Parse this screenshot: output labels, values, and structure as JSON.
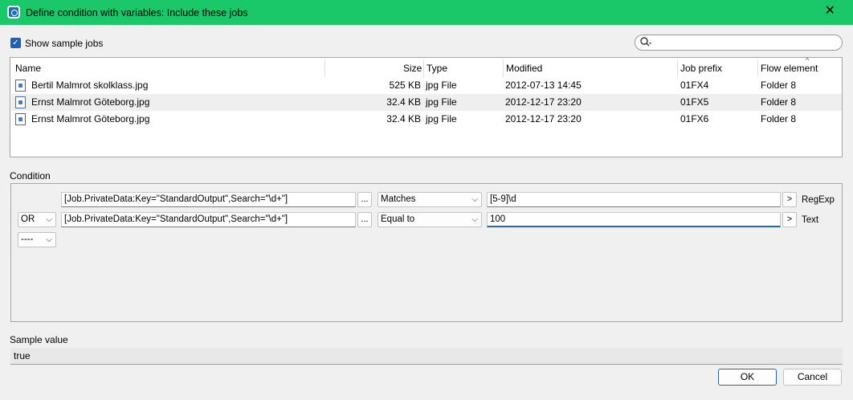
{
  "window": {
    "title": "Define condition with variables: Include these jobs",
    "close_glyph": "✕"
  },
  "toolbar": {
    "show_sample_jobs_label": "Show sample jobs",
    "show_sample_jobs_checked": true,
    "search_placeholder": ""
  },
  "jobs_table": {
    "columns": [
      "Name",
      "Size",
      "Type",
      "Modified",
      "Job prefix",
      "Flow element"
    ],
    "rows": [
      {
        "name": "Bertil Malmrot skolklass.jpg",
        "size": "525 KB",
        "type": "jpg File",
        "modified": "2012-07-13 14:45",
        "prefix": "01FX4",
        "element": "Folder 8"
      },
      {
        "name": "Ernst Malmrot Göteborg.jpg",
        "size": "32.4 KB",
        "type": "jpg File",
        "modified": "2012-12-17 23:20",
        "prefix": "01FX5",
        "element": "Folder 8"
      },
      {
        "name": "Ernst Malmrot Göteborg.jpg",
        "size": "32.4 KB",
        "type": "jpg File",
        "modified": "2012-12-17 23:20",
        "prefix": "01FX6",
        "element": "Folder 8"
      }
    ]
  },
  "condition": {
    "label": "Condition",
    "rows": [
      {
        "logic": "",
        "variable": "[Job.PrivateData:Key=\"StandardOutput\",Search=\"\\d+\"]",
        "browse": "...",
        "operator": "Matches",
        "value": "[5-9]\\d",
        "apply": ">",
        "type": "RegExp"
      },
      {
        "logic": "OR",
        "variable": "[Job.PrivateData:Key=\"StandardOutput\",Search=\"\\d+\"]",
        "browse": "...",
        "operator": "Equal to",
        "value": "100",
        "apply": ">",
        "type": "Text"
      }
    ],
    "add_logic": "----"
  },
  "sample": {
    "label": "Sample value",
    "value": "true"
  },
  "buttons": {
    "ok": "OK",
    "cancel": "Cancel"
  },
  "colors": {
    "titlebar": "#1ac869",
    "accent": "#1d5fb8"
  }
}
